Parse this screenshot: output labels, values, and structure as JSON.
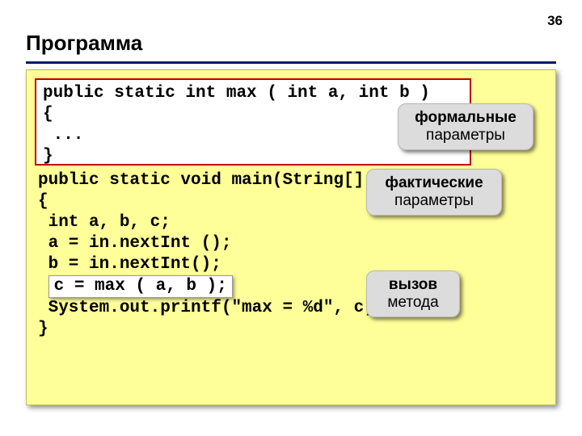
{
  "page_number": "36",
  "title": "Программа",
  "method": {
    "l1": "public static int max ( int a, int b )",
    "l2": "{",
    "l3": " ...",
    "l4": "}"
  },
  "main": {
    "l1": "public static void main(String[] args)",
    "l2": "{",
    "l3": " int a, b, c;",
    "l4": " a = in.nextInt ();",
    "l5": " b = in.nextInt();",
    "l6_pre": " ",
    "l6_box": "c = max ( a, b );",
    "l7": " System.out.printf(\"max = %d\", c);",
    "l8": "}"
  },
  "callouts": {
    "c1_bold": "формальные",
    "c1_rest": "параметры",
    "c2_bold": "фактические",
    "c2_rest": "параметры",
    "c3_bold": "вызов",
    "c3_rest": "метода"
  }
}
